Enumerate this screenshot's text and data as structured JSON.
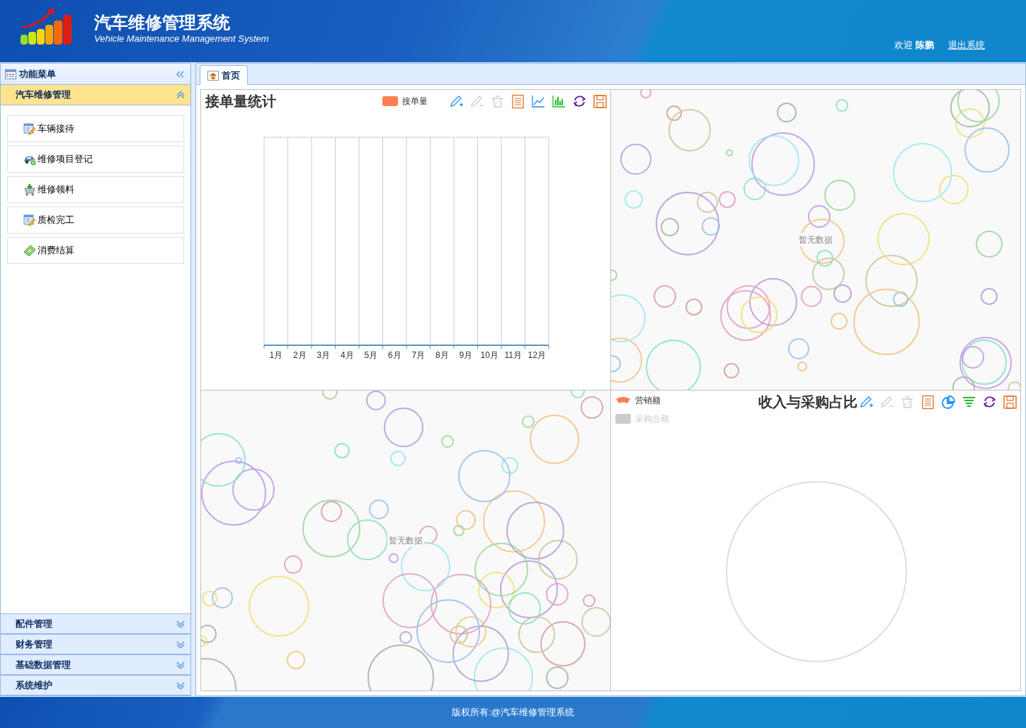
{
  "header": {
    "title": "汽车维修管理系统",
    "subtitle": "Vehicle Maintenance Management System",
    "welcome": "欢迎",
    "user": "陈鹏",
    "logout": "退出系统"
  },
  "sidebar": {
    "title": "功能菜单",
    "sections": [
      {
        "title": "汽车维修管理",
        "expanded": true,
        "items": [
          {
            "label": "车辆接待",
            "kind": "form"
          },
          {
            "label": "维修项目登记",
            "kind": "car"
          },
          {
            "label": "维修领料",
            "kind": "cart"
          },
          {
            "label": "质检完工",
            "kind": "form"
          },
          {
            "label": "消费结算",
            "kind": "money"
          }
        ]
      },
      {
        "title": "配件管理",
        "expanded": false
      },
      {
        "title": "财务管理",
        "expanded": false
      },
      {
        "title": "基础数据管理",
        "expanded": false
      },
      {
        "title": "系统维护",
        "expanded": false
      }
    ]
  },
  "tabs": [
    {
      "label": "首页",
      "selected": true
    }
  ],
  "panels": [
    {
      "kind": "bar",
      "title": "接单量统计",
      "legend": [
        {
          "label": "接单量",
          "color": "#ff7f50",
          "on": true
        }
      ],
      "toolbox": [
        {
          "kind": "mark",
          "disabled": false
        },
        {
          "kind": "unmark",
          "disabled": true
        },
        {
          "kind": "clear",
          "disabled": true
        },
        {
          "kind": "data",
          "disabled": false
        },
        {
          "kind": "line",
          "disabled": false
        },
        {
          "kind": "bar",
          "disabled": false
        },
        {
          "kind": "refresh",
          "disabled": false
        },
        {
          "kind": "save",
          "disabled": false
        }
      ],
      "x_labels": [
        "1月",
        "2月",
        "3月",
        "4月",
        "5月",
        "6月",
        "7月",
        "8月",
        "9月",
        "10月",
        "11月",
        "12月"
      ]
    },
    {
      "kind": "empty",
      "message": "暂无数据"
    },
    {
      "kind": "empty",
      "message": "暂无数据"
    },
    {
      "kind": "pie",
      "title": "收入与采购占比",
      "legend": [
        {
          "label": "营销额",
          "color": "#ff7f50",
          "on": true
        },
        {
          "label": "采购总额",
          "color": "#cccccc",
          "on": false
        }
      ],
      "toolbox": [
        {
          "kind": "mark",
          "disabled": false
        },
        {
          "kind": "unmark",
          "disabled": true
        },
        {
          "kind": "clear",
          "disabled": true
        },
        {
          "kind": "data",
          "disabled": false
        },
        {
          "kind": "pie",
          "disabled": false
        },
        {
          "kind": "funnel",
          "disabled": false
        },
        {
          "kind": "refresh",
          "disabled": false
        },
        {
          "kind": "save",
          "disabled": false
        }
      ]
    }
  ],
  "footer": "版权所有:@汽车维修管理系统"
}
